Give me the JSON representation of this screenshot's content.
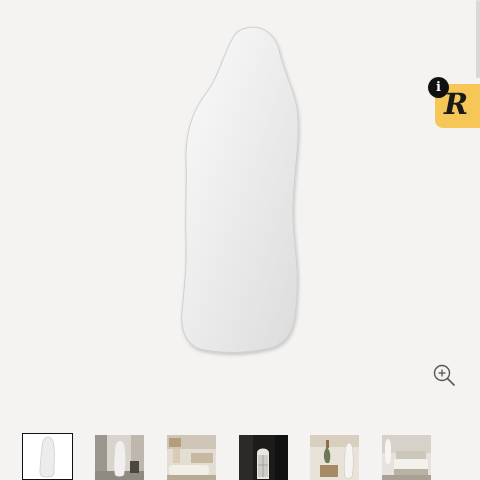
{
  "product_gallery": {
    "main_image": {
      "subject": "irregular-shaped-mirror",
      "background_color": "#f4f3f1"
    },
    "zoom": {
      "icon": "zoom-in-icon"
    },
    "badge": {
      "logo_letter": "R",
      "info_label": "i",
      "color": "#f6c756"
    },
    "thumbnails": [
      {
        "subject": "mirror",
        "selected": true
      },
      {
        "subject": "mirror-in-room",
        "selected": false
      },
      {
        "subject": "living-room",
        "selected": false
      },
      {
        "subject": "dark-hallway",
        "selected": false
      },
      {
        "subject": "entryway",
        "selected": false
      },
      {
        "subject": "bedroom",
        "selected": false
      }
    ]
  }
}
